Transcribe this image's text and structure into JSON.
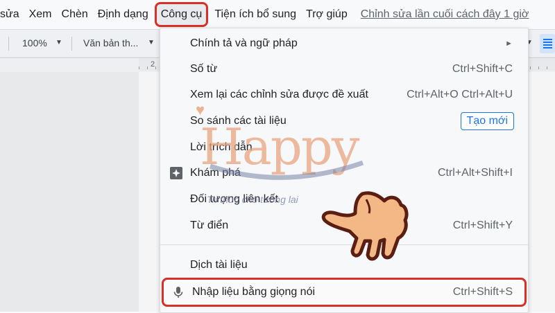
{
  "menubar": {
    "items": [
      "sửa",
      "Xem",
      "Chèn",
      "Định dạng",
      "Công cụ",
      "Tiện ích bổ sung",
      "Trợ giúp"
    ],
    "last_edit": "Chỉnh sửa lần cuối cách đây 1 giờ"
  },
  "toolbar": {
    "zoom": "100%",
    "style": "Văn bản th..."
  },
  "ruler": {
    "mark": "2"
  },
  "tools_menu": {
    "items": [
      {
        "label": "Chính tả và ngữ pháp",
        "shortcut": "",
        "submenu": true
      },
      {
        "label": "Số từ",
        "shortcut": "Ctrl+Shift+C"
      },
      {
        "label": "Xem lại các chỉnh sửa được đề xuất",
        "shortcut": "Ctrl+Alt+O Ctrl+Alt+U"
      },
      {
        "label": "So sánh các tài liệu",
        "badge": "Tạo mới"
      },
      {
        "label": "Lời trích dẫn",
        "shortcut": ""
      },
      {
        "label": "Khám phá",
        "shortcut": "Ctrl+Alt+Shift+I",
        "icon": "explore-sparkle-icon"
      },
      {
        "label": "Đối tượng liên kết",
        "shortcut": ""
      },
      {
        "label": "Từ điển",
        "shortcut": "Ctrl+Shift+Y"
      },
      {
        "label": "Dịch tài liệu",
        "shortcut": ""
      },
      {
        "label": "Nhập liệu bằng giọng nói",
        "shortcut": "Ctrl+Shift+S",
        "icon": "microphone-icon"
      }
    ]
  },
  "watermark": {
    "brand": "Happy",
    "tagline": "Tri thức cho tương lai"
  },
  "colors": {
    "highlight": "#d93025",
    "accent": "#1a73e8"
  }
}
